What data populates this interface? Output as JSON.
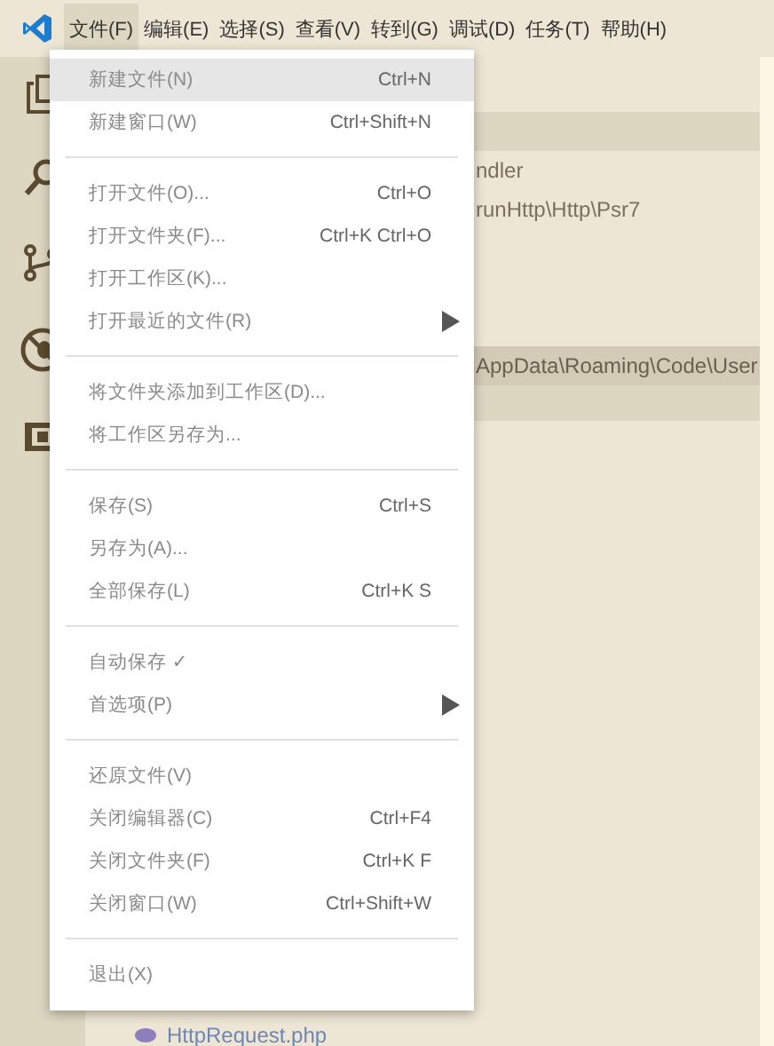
{
  "menubar": [
    {
      "label": "文件(F)",
      "selected": true
    },
    {
      "label": "编辑(E)",
      "selected": false
    },
    {
      "label": "选择(S)",
      "selected": false
    },
    {
      "label": "查看(V)",
      "selected": false
    },
    {
      "label": "转到(G)",
      "selected": false
    },
    {
      "label": "调试(D)",
      "selected": false
    },
    {
      "label": "任务(T)",
      "selected": false
    },
    {
      "label": "帮助(H)",
      "selected": false
    }
  ],
  "sidebar": {
    "rows": [
      {
        "kind": "header"
      },
      {
        "text": "ndler",
        "selected": false,
        "kind": "row"
      },
      {
        "text": "runHttp\\Http\\Psr7",
        "selected": false,
        "kind": "row"
      },
      {
        "kind": "blank"
      },
      {
        "kind": "blank"
      },
      {
        "kind": "blank"
      },
      {
        "text": "AppData\\Roaming\\Code\\User",
        "selected": true,
        "kind": "row"
      },
      {
        "kind": "hover"
      }
    ],
    "bottom_file": "HttpRequest.php"
  },
  "file_menu": [
    [
      {
        "label": "新建文件(N)",
        "shortcut": "Ctrl+N",
        "submenu": false,
        "selected": true
      },
      {
        "label": "新建窗口(W)",
        "shortcut": "Ctrl+Shift+N",
        "submenu": false,
        "selected": false
      }
    ],
    [
      {
        "label": "打开文件(O)...",
        "shortcut": "Ctrl+O",
        "submenu": false,
        "selected": false
      },
      {
        "label": "打开文件夹(F)...",
        "shortcut": "Ctrl+K Ctrl+O",
        "submenu": false,
        "selected": false
      },
      {
        "label": "打开工作区(K)...",
        "submenu": false,
        "selected": false
      },
      {
        "label": "打开最近的文件(R)",
        "submenu": true,
        "selected": false
      }
    ],
    [
      {
        "label": "将文件夹添加到工作区(D)...",
        "submenu": false,
        "selected": false
      },
      {
        "label": "将工作区另存为...",
        "submenu": false,
        "selected": false
      }
    ],
    [
      {
        "label": "保存(S)",
        "shortcut": "Ctrl+S",
        "submenu": false,
        "selected": false
      },
      {
        "label": "另存为(A)...",
        "submenu": false,
        "selected": false
      },
      {
        "label": "全部保存(L)",
        "shortcut": "Ctrl+K S",
        "submenu": false,
        "selected": false
      }
    ],
    [
      {
        "label": "自动保存 ✓",
        "submenu": false,
        "selected": false
      },
      {
        "label": "首选项(P)",
        "submenu": true,
        "selected": false
      }
    ],
    [
      {
        "label": "还原文件(V)",
        "submenu": false,
        "selected": false
      },
      {
        "label": "关闭编辑器(C)",
        "shortcut": "Ctrl+F4",
        "submenu": false,
        "selected": false
      },
      {
        "label": "关闭文件夹(F)",
        "shortcut": "Ctrl+K F",
        "submenu": false,
        "selected": false
      },
      {
        "label": "关闭窗口(W)",
        "shortcut": "Ctrl+Shift+W",
        "submenu": false,
        "selected": false
      }
    ],
    [
      {
        "label": "退出(X)",
        "submenu": false,
        "selected": false
      }
    ]
  ]
}
